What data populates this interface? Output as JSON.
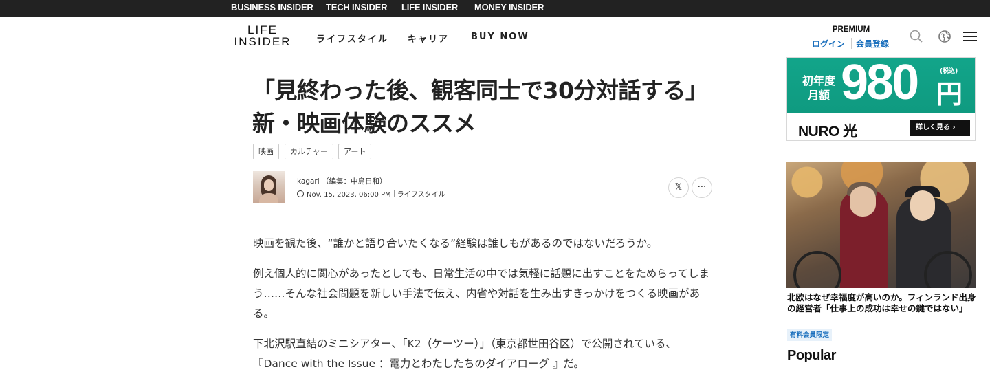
{
  "network": [
    "BUSINESS INSIDER",
    "TECH INSIDER",
    "LIFE INSIDER",
    "MONEY INSIDER"
  ],
  "header": {
    "logo_line1": "LIFE",
    "logo_line2": "INSIDER",
    "nav": [
      "ライフスタイル",
      "キャリア",
      "BUY NOW"
    ],
    "premium": "PREMIUM",
    "login": "ログイン",
    "register": "会員登録",
    "icons": [
      "search-icon",
      "globe-icon",
      "menu-icon"
    ]
  },
  "article": {
    "title_line1": "「見終わった後、観客同士で30分対話する」",
    "title_line2": "新・映画体験のススメ",
    "tags": [
      "映画",
      "カルチャー",
      "アート"
    ],
    "author": "kagari （編集：中島日和）",
    "date": "Nov. 15, 2023, 06:00 PM",
    "category": "ライフスタイル",
    "share_x": "𝕏",
    "share_more": "···",
    "paragraphs": [
      "映画を観た後、“誰かと語り合いたくなる”経験は誰しもがあるのではないだろうか。",
      "例え個人的に関心があったとしても、日常生活の中では気軽に話題に出すことをためらってしまう……そんな社会問題を新しい手法で伝え、内省や対話を生み出すきっかけをつくる映画がある。",
      "下北沢駅直結のミニシアター、「K2（ケーツー）」（東京都世田谷区）で公開されている、『Dance with the Issue ：電力とわたしたちのダイアローグ 』だ。"
    ]
  },
  "ad": {
    "year_line1": "初年度",
    "year_line2": "月額",
    "price": "980",
    "yen": "円",
    "tax": "(税込)",
    "brand": "NURO 光",
    "cta": "詳しく見る ›",
    "color": "#12a58a"
  },
  "promo": {
    "title": "北欧はなぜ幸福度が高いのか。フィンランド出身の経営者「仕事上の成功は幸せの鍵ではない」",
    "badge": "有料会員限定"
  },
  "sidebar_heading": "Popular",
  "colors": {
    "link": "#1a6fbd",
    "topbar": "#222222"
  }
}
